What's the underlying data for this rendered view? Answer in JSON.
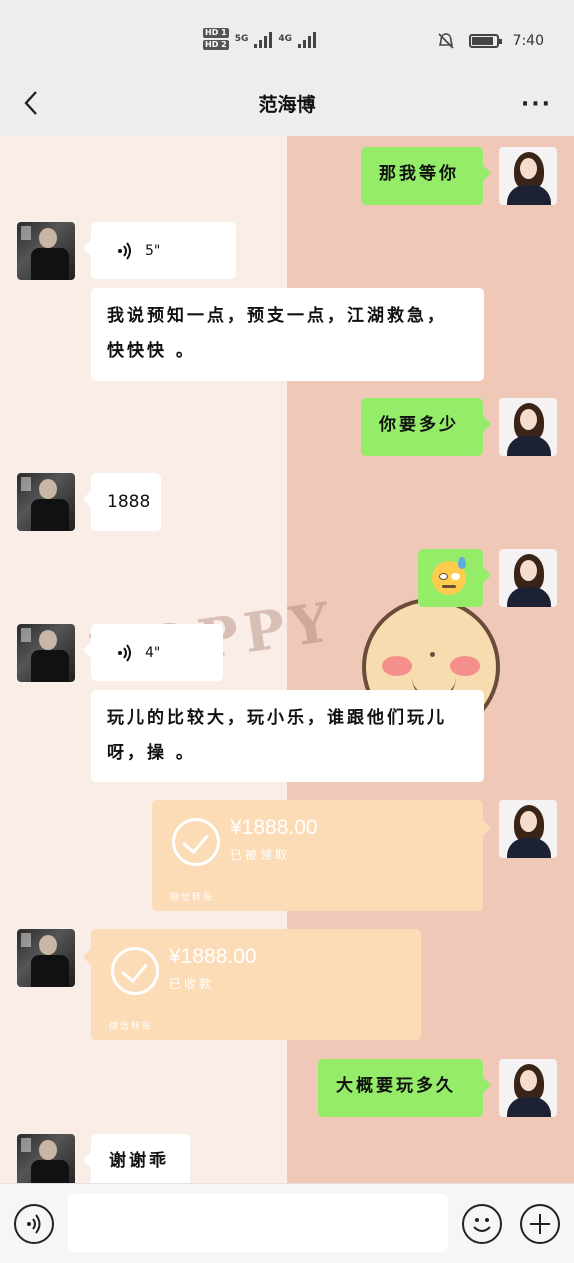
{
  "status_bar": {
    "hd1": "HD 1",
    "hd2": "HD 2",
    "net1": "5G",
    "net2": "4G",
    "time": "7:40"
  },
  "header": {
    "title": "范海博",
    "back_icon": "chevron-left-icon",
    "more_icon": "more-dots-icon",
    "more_label": "···"
  },
  "background": {
    "deco_text": "HOPPY",
    "colors": {
      "left": "#faece6",
      "right": "#f0c8b8"
    }
  },
  "messages": [
    {
      "side": "right",
      "type": "text",
      "text": "那我等你"
    },
    {
      "side": "left",
      "type": "voice",
      "duration": "5\""
    },
    {
      "side": "left",
      "type": "text",
      "lines": [
        "我说预知一点，预支一点，江湖救急，",
        "快快快 。"
      ]
    },
    {
      "side": "right",
      "type": "text",
      "text": "你要多少"
    },
    {
      "side": "left",
      "type": "text",
      "text": "1888"
    },
    {
      "side": "right",
      "type": "emoji",
      "icon": "sweat-smile-emoji-icon"
    },
    {
      "side": "left",
      "type": "voice",
      "duration": "4\""
    },
    {
      "side": "left",
      "type": "text",
      "lines": [
        "玩儿的比较大，玩小乐，谁跟他们玩儿",
        "呀，操 。"
      ]
    },
    {
      "side": "right",
      "type": "transfer",
      "amount": "¥1888.00",
      "status": "已被领取",
      "footer": "微信转账"
    },
    {
      "side": "left",
      "type": "transfer",
      "amount": "¥1888.00",
      "status": "已收款",
      "footer": "微信转账"
    },
    {
      "side": "right",
      "type": "text",
      "text": "大概要玩多久"
    },
    {
      "side": "left",
      "type": "text",
      "text": "谢谢乖"
    }
  ],
  "input_bar": {
    "voice_icon": "voice-mode-icon",
    "input_value": "",
    "emoji_icon": "emoji-icon",
    "plus_icon": "plus-icon"
  }
}
